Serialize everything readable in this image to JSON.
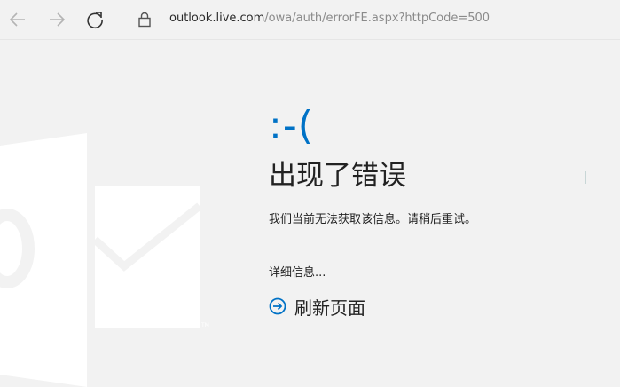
{
  "browser": {
    "url_host": "outlook.live.com",
    "url_path": "/owa/auth/errorFE.aspx?httpCode=500"
  },
  "error": {
    "face": ":-(",
    "heading": "出现了错误",
    "message": "我们当前无法获取该信息。请稍后重试。",
    "details_link": "详细信息...",
    "refresh_label": "刷新页面"
  },
  "colors": {
    "accent": "#0072c6",
    "background": "#f2f2f2",
    "logo": "#ffffff"
  },
  "icons": {
    "back": "back-arrow-icon",
    "forward": "forward-arrow-icon",
    "reload": "reload-icon",
    "lock": "lock-icon",
    "logo": "outlook-logo-icon",
    "refresh": "arrow-circle-right-icon"
  }
}
